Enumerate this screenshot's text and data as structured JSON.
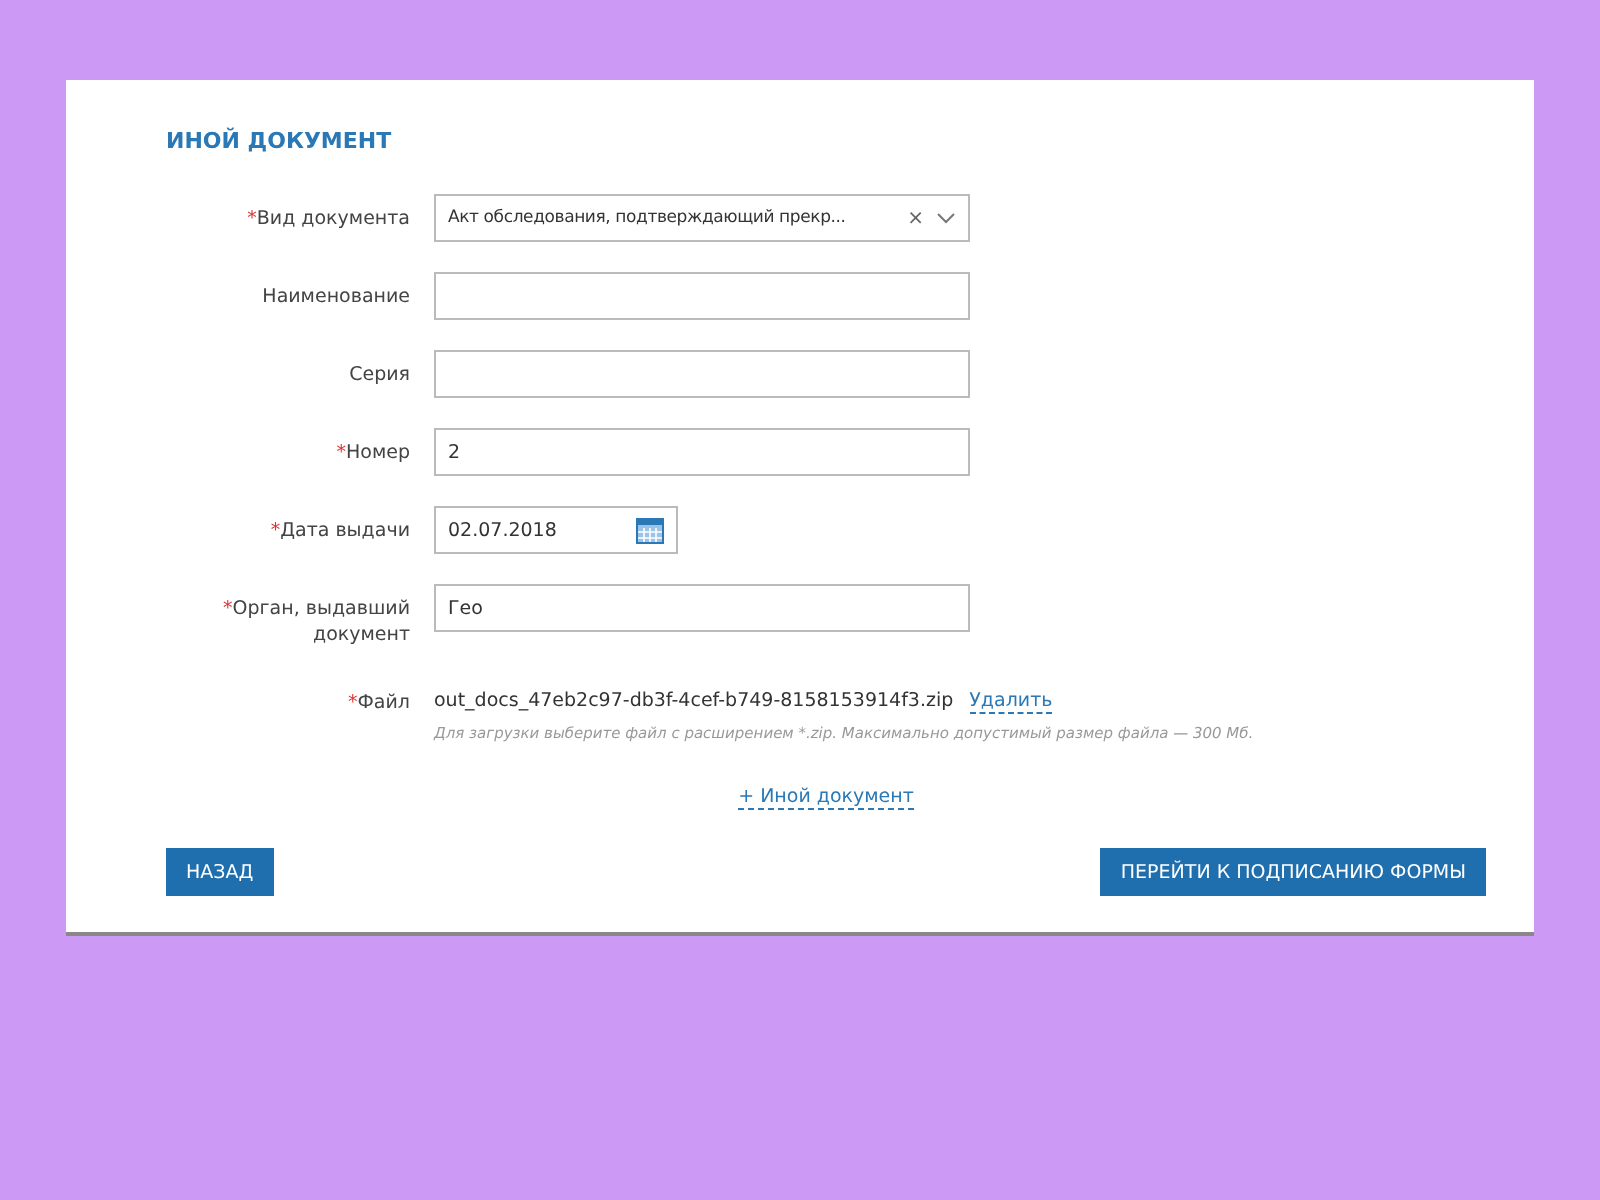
{
  "title": "ИНОЙ ДОКУМЕНТ",
  "fields": [
    {
      "kind": "select",
      "marker": "*",
      "label": "Вид документа",
      "value": "Акт обследования, подтверждающий прекр...",
      "clear": "×"
    },
    {
      "kind": "text",
      "label": "Наименование"
    },
    {
      "kind": "text",
      "label": "Серия"
    },
    {
      "kind": "text",
      "marker": "*",
      "label": "Номер",
      "value": "2"
    },
    {
      "kind": "date",
      "marker": "*",
      "label": "Дата выдачи",
      "value": "02.07.2018"
    },
    {
      "kind": "text",
      "marker": "*",
      "label": "Орган, выдавший документ",
      "value": "Гео"
    }
  ],
  "file": {
    "marker": "*",
    "label": "Файл",
    "name": "out_docs_47eb2c97-db3f-4cef-b749-8158153914f3.zip",
    "delete": "Удалить",
    "hint": "Для загрузки выберите файл с расширением *.zip. Максимально допустимый размер файла — 300 Мб."
  },
  "add_link": "+ Иной документ",
  "buttons": {
    "back": "НАЗАД",
    "next": "ПЕРЕЙТИ К ПОДПИСАНИЮ ФОРМЫ"
  }
}
